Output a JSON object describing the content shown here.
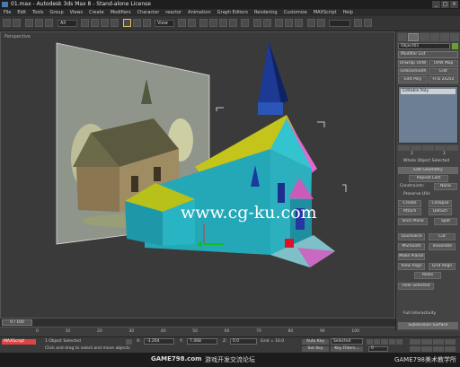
{
  "window": {
    "title": "01.max - Autodesk 3ds Max 8 - Stand-alone License",
    "min": "_",
    "max": "□",
    "close": "×"
  },
  "menu": [
    "File",
    "Edit",
    "Tools",
    "Group",
    "Views",
    "Create",
    "Modifiers",
    "Character",
    "reactor",
    "Animation",
    "Graph Editors",
    "Rendering",
    "Customize",
    "MAXScript",
    "Help"
  ],
  "toolbar": {
    "selection_filter": "All",
    "ref_coord": "View"
  },
  "viewport": {
    "label": "Perspective"
  },
  "panel": {
    "object_name": "Object01",
    "modifier_list": "Modifier List",
    "buttons": [
      "Unwrap UVW",
      "UVW Map",
      "TurboSmooth",
      "Edit",
      "Edit Poly",
      "FFD 2x2x2"
    ],
    "stack_item": "Editable Poly",
    "spinner_values": [
      "2",
      "2"
    ],
    "selected_label": "Whole Object Selected",
    "rollout_edit_geometry": "Edit Geometry",
    "repeat_last": "Repeat Last",
    "constraints": "Constraints:",
    "constraints_value": "None",
    "preserve_uvs": "Preserve UVs",
    "create": "Create",
    "collapse": "Collapse",
    "attach": "Attach",
    "detach": "Detach",
    "slice_plane": "Slice Plane",
    "split": "Split",
    "quickslice": "QuickSlice",
    "cut": "Cut",
    "msmooth": "MSmooth",
    "tessellate": "Tessellate",
    "make_planar": "Make Planar",
    "view_align": "View Align",
    "grid_align": "Grid Align",
    "relax": "Relax",
    "hide_selected": "Hide Selected",
    "full_interactivity": "Full Interactivity",
    "subdivision": "Subdivision Surface"
  },
  "timeline": {
    "frame": "0 / 100",
    "ticks": [
      "0",
      "10",
      "20",
      "30",
      "40",
      "50",
      "60",
      "70",
      "80",
      "90",
      "100"
    ]
  },
  "status": {
    "maxscript": "MAXScript",
    "selected_count": "1 Object Selected",
    "prompt": "Click and drag to select and move objects",
    "x_label": "X:",
    "x_value": "-3.264",
    "y_label": "Y:",
    "y_value": "7.468",
    "z_label": "Z:",
    "z_value": "0.0",
    "grid": "Grid = 10.0",
    "auto_key": "Auto Key",
    "set_key": "Set Key",
    "key_mode": "Selected",
    "key_filters": "Key Filters...",
    "frame_value": "0"
  },
  "watermark": "www.cg-ku.com",
  "footer": {
    "left": "GAME798.com",
    "center": "游戏开发交流论坛",
    "right": "GAME798美术教学所"
  }
}
